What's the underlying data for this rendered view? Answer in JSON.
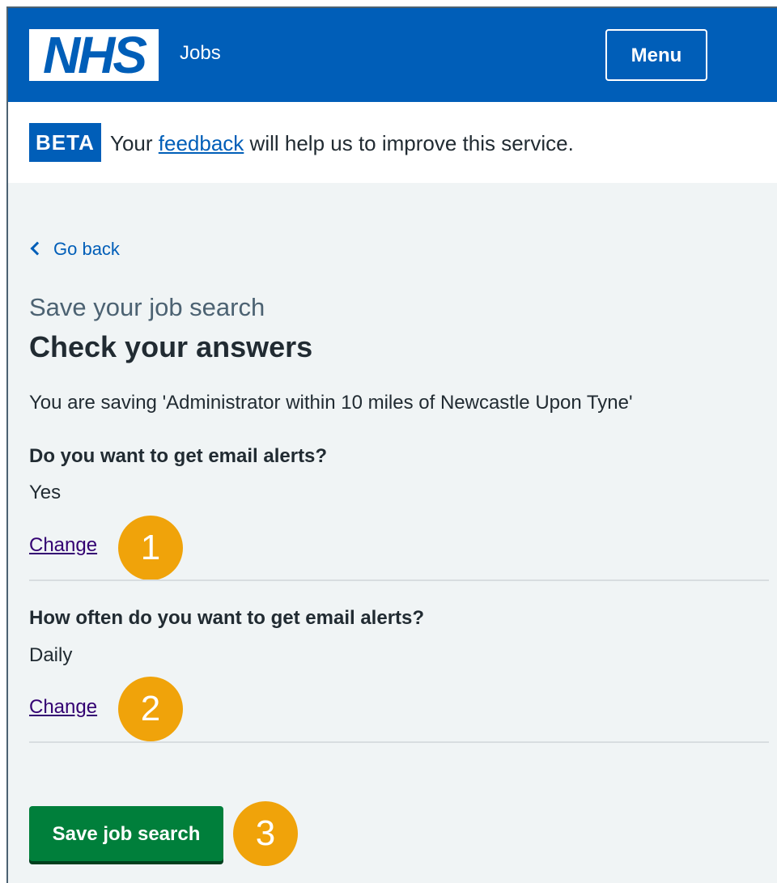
{
  "header": {
    "logo_text": "NHS",
    "service_name": "Jobs",
    "menu_label": "Menu"
  },
  "beta": {
    "tag": "BETA",
    "text_before": "Your",
    "link_text": "feedback",
    "text_after": "will help us to improve this service."
  },
  "back_link": "Go back",
  "caption": "Save your job search",
  "title": "Check your answers",
  "intro": "You are saving 'Administrator within 10 miles of Newcastle Upon Tyne'",
  "rows": [
    {
      "key": "Do you want to get email alerts?",
      "value": "Yes",
      "action": "Change",
      "callout": "1"
    },
    {
      "key": "How often do you want to get email alerts?",
      "value": "Daily",
      "action": "Change",
      "callout": "2"
    }
  ],
  "submit": {
    "label": "Save job search",
    "callout": "3"
  },
  "colors": {
    "nhs_blue": "#005eb8",
    "page_background": "#f0f4f5",
    "button_green": "#007f3b",
    "callout_orange": "#f0a30a",
    "visited_link": "#330072"
  },
  "icons": {
    "back": "chevron-left-icon"
  }
}
